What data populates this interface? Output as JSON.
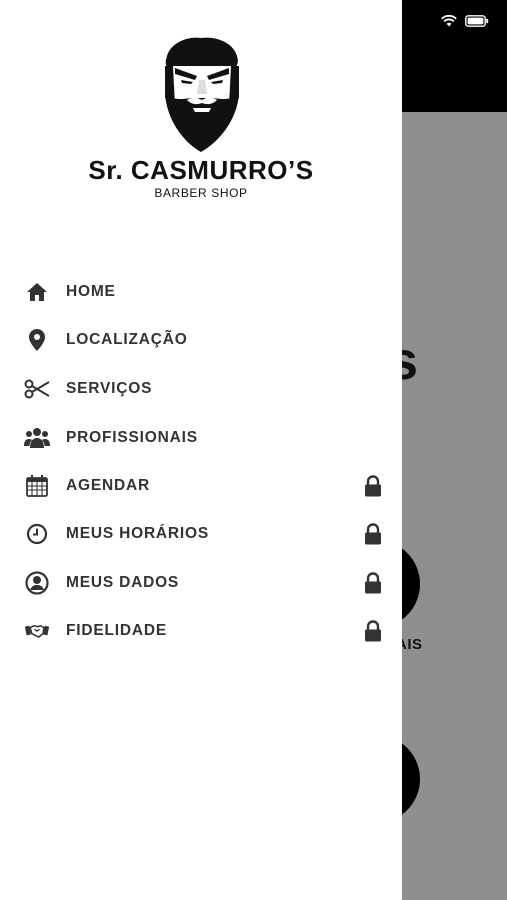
{
  "brand": {
    "title": "Sr. CASMURRO’S",
    "subtitle": "BARBER SHOP",
    "logo_icon": "bearded-man-logo"
  },
  "status_bar": {
    "wifi_icon": "wifi-icon",
    "battery_icon": "battery-icon"
  },
  "background": {
    "heading_fragment": "s",
    "label_fragment": "AIS"
  },
  "menu": {
    "items": [
      {
        "label": "HOME",
        "icon": "home-icon",
        "locked": false
      },
      {
        "label": "LOCALIZAÇÃO",
        "icon": "map-pin-icon",
        "locked": false
      },
      {
        "label": "SERVIÇOS",
        "icon": "scissors-icon",
        "locked": false
      },
      {
        "label": "PROFISSIONAIS",
        "icon": "users-icon",
        "locked": false
      },
      {
        "label": "AGENDAR",
        "icon": "calendar-icon",
        "locked": true
      },
      {
        "label": "MEUS HORÁRIOS",
        "icon": "clock-icon",
        "locked": true
      },
      {
        "label": "MEUS DADOS",
        "icon": "user-circle-icon",
        "locked": true
      },
      {
        "label": "FIDELIDADE",
        "icon": "handshake-icon",
        "locked": true
      }
    ]
  },
  "colors": {
    "drawer_bg": "#ffffff",
    "overlay": "#8f8f8f",
    "text": "#333333",
    "header_bg": "#000000"
  }
}
